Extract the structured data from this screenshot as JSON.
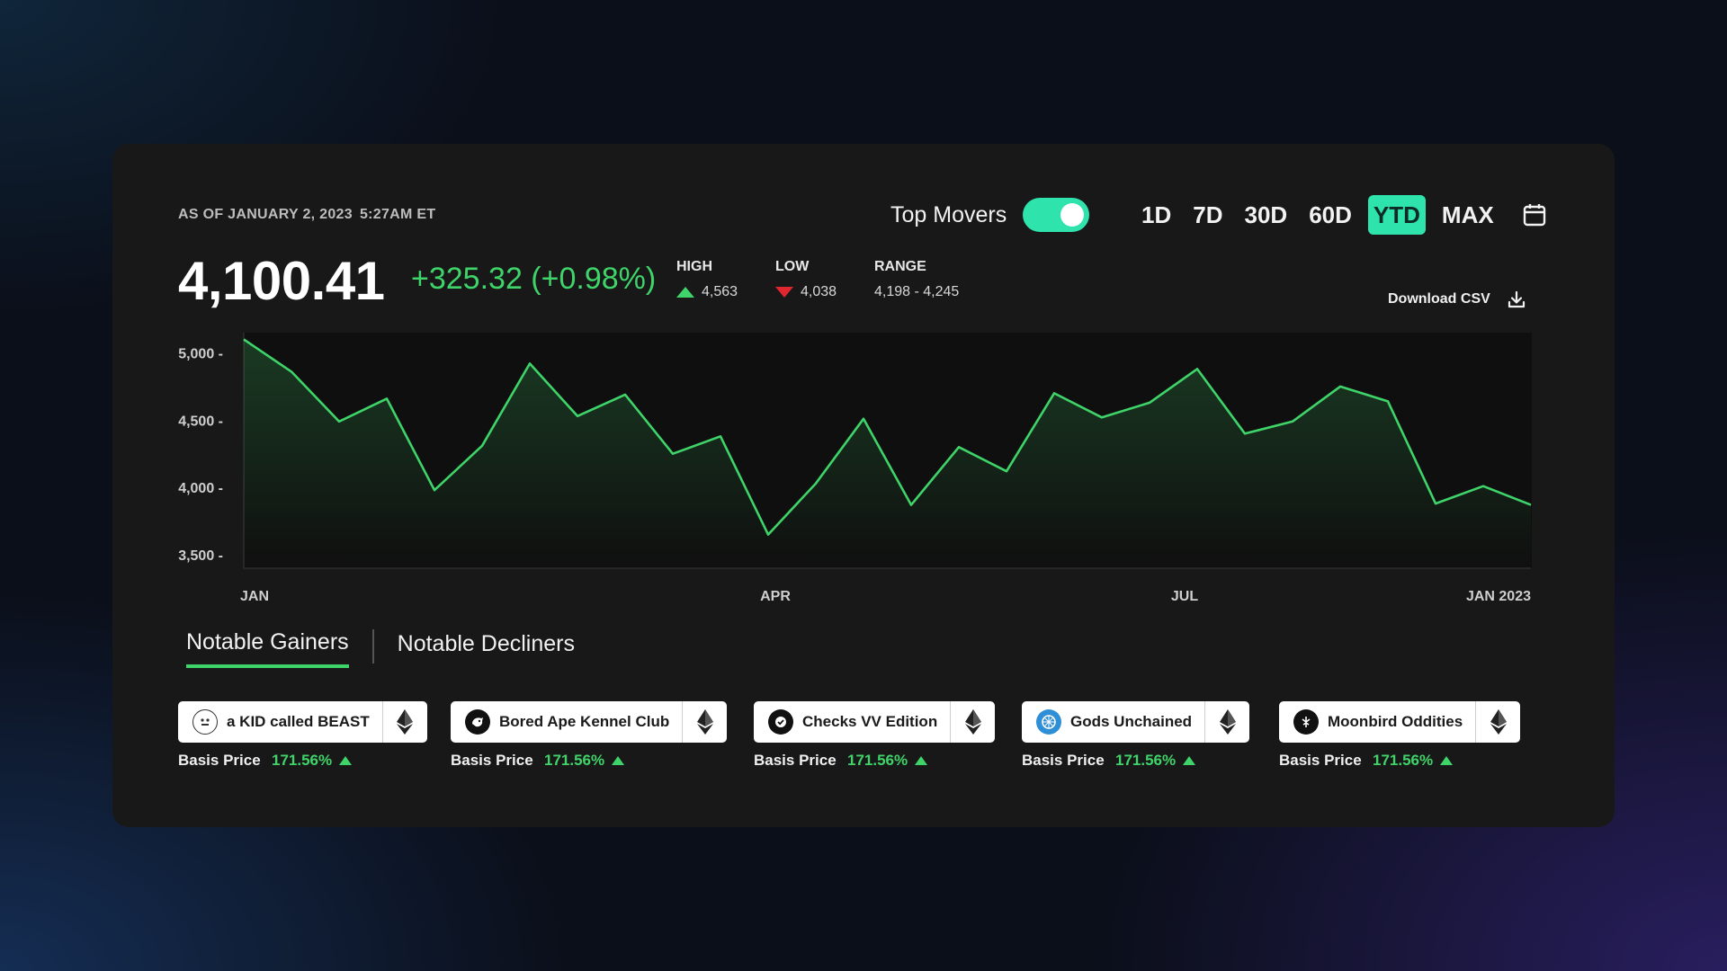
{
  "header": {
    "as_of_date": "AS OF JANUARY 2, 2023",
    "as_of_time": "5:27AM ET",
    "top_movers_label": "Top Movers",
    "top_movers_on": true,
    "ranges": [
      "1D",
      "7D",
      "30D",
      "60D",
      "YTD",
      "MAX"
    ],
    "active_range": "YTD"
  },
  "summary": {
    "price": "4,100.41",
    "change": "+325.32 (+0.98%)",
    "high_label": "HIGH",
    "high_value": "4,563",
    "low_label": "LOW",
    "low_value": "4,038",
    "range_label": "RANGE",
    "range_value": "4,198 - 4,245",
    "download_label": "Download CSV"
  },
  "colors": {
    "accent": "#2fe3ad",
    "gain": "#3fd469",
    "loss": "#e0262e",
    "card": "#181818"
  },
  "chart_data": {
    "type": "area",
    "ylim": [
      3400,
      5150
    ],
    "y_ticks": [
      5000,
      4500,
      4000,
      3500
    ],
    "y_tick_labels": [
      "5,000 -",
      "4,500 -",
      "4,000 -",
      "3,500 -"
    ],
    "x_tick_labels": [
      "JAN",
      "APR",
      "JUL",
      "JAN 2023"
    ],
    "values": [
      5100,
      4860,
      4490,
      4660,
      3980,
      4310,
      4920,
      4530,
      4690,
      4250,
      4380,
      3650,
      4030,
      4510,
      3870,
      4300,
      4120,
      4700,
      4520,
      4630,
      4880,
      4400,
      4490,
      4750,
      4640,
      3880,
      4010,
      3870
    ],
    "grid": false
  },
  "tabs": [
    {
      "label": "Notable Gainers",
      "active": true
    },
    {
      "label": "Notable Decliners",
      "active": false
    }
  ],
  "movers": [
    {
      "name": "a KID called BEAST",
      "icon": "beast-face-icon",
      "basis_label": "Basis Price",
      "pct": "171.56%"
    },
    {
      "name": "Bored Ape Kennel Club",
      "icon": "dog-logo-icon",
      "basis_label": "Basis Price",
      "pct": "171.56%"
    },
    {
      "name": "Checks VV Edition",
      "icon": "check-badge-icon",
      "basis_label": "Basis Price",
      "pct": "171.56%"
    },
    {
      "name": "Gods Unchained",
      "icon": "gods-unchained-logo-icon",
      "basis_label": "Basis Price",
      "pct": "171.56%"
    },
    {
      "name": "Moonbird Oddities",
      "icon": "moonbird-logo-icon",
      "basis_label": "Basis Price",
      "pct": "171.56%"
    }
  ]
}
